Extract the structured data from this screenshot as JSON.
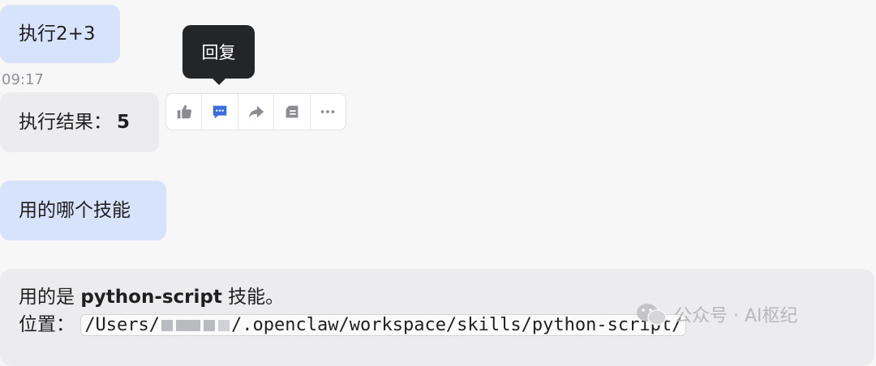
{
  "messages": {
    "m1": "执行2+3",
    "timestamp": "09:17",
    "m2_prefix": "执行结果：",
    "m2_result": "5",
    "m3": "用的哪个技能",
    "m4": {
      "l1_a": "用的是 ",
      "l1_skill": "python-script",
      "l1_b": " 技能。",
      "l2_label": "位置：",
      "l2_path_start": "/Users/",
      "l2_path_end": "/.openclaw/workspace/skills/python-script/"
    }
  },
  "toolbar": {
    "tooltip": "回复",
    "icons": [
      "thumb-up-icon",
      "reply-icon",
      "share-icon",
      "quote-icon",
      "more-icon"
    ]
  },
  "watermark": {
    "text": "公众号 · AI枢纪"
  },
  "colors": {
    "user_bubble": "#d6e3fb",
    "bot_bubble": "#ececee",
    "accent": "#3b6ce0"
  }
}
